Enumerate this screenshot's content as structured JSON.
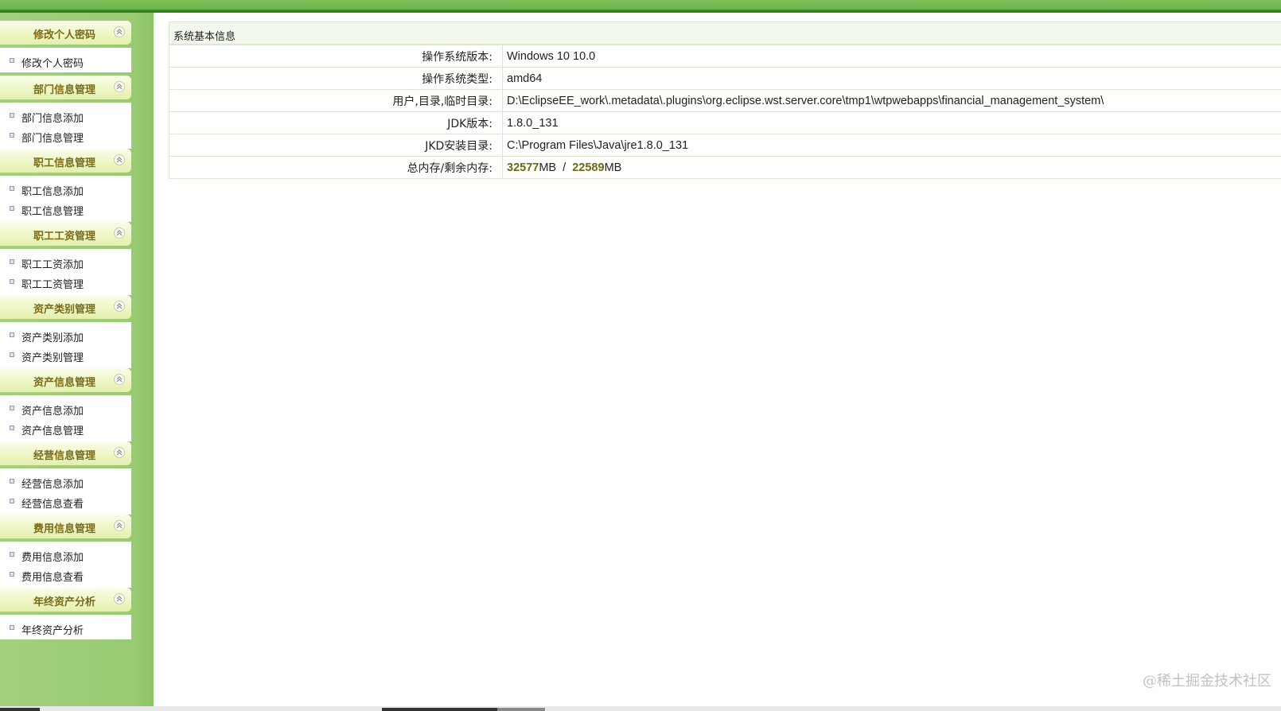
{
  "sidebar": {
    "groups": [
      {
        "title": "修改个人密码",
        "items": [
          "修改个人密码"
        ]
      },
      {
        "title": "部门信息管理",
        "items": [
          "部门信息添加",
          "部门信息管理"
        ]
      },
      {
        "title": "职工信息管理",
        "items": [
          "职工信息添加",
          "职工信息管理"
        ]
      },
      {
        "title": "职工工资管理",
        "items": [
          "职工工资添加",
          "职工工资管理"
        ]
      },
      {
        "title": "资产类别管理",
        "items": [
          "资产类别添加",
          "资产类别管理"
        ]
      },
      {
        "title": "资产信息管理",
        "items": [
          "资产信息添加",
          "资产信息管理"
        ]
      },
      {
        "title": "经营信息管理",
        "items": [
          "经营信息添加",
          "经营信息查看"
        ]
      },
      {
        "title": "费用信息管理",
        "items": [
          "费用信息添加",
          "费用信息查看"
        ]
      },
      {
        "title": "年终资产分析",
        "items": [
          "年终资产分析"
        ]
      }
    ],
    "toggle_icon": "collapse-up-icon"
  },
  "main": {
    "panel_title": "系统基本信息",
    "rows": [
      {
        "label": "操作系统版本:",
        "value": "Windows 10  10.0"
      },
      {
        "label": "操作系统类型:",
        "value": "amd64"
      },
      {
        "label": "用户,目录,临时目录:",
        "value": "D:\\EclipseEE_work\\.metadata\\.plugins\\org.eclipse.wst.server.core\\tmp1\\wtpwebapps\\financial_management_system\\"
      },
      {
        "label": "JDK版本:",
        "value": "1.8.0_131"
      },
      {
        "label": "JKD安装目录:",
        "value": "C:\\Program Files\\Java\\jre1.8.0_131"
      }
    ],
    "memory": {
      "label": "总内存/剩余内存:",
      "total": "32577",
      "total_unit": "MB",
      "separator": "/",
      "free": "22589",
      "free_unit": "MB"
    }
  },
  "watermark": "@稀土掘金技术社区",
  "colors": {
    "sidebar_bg": "#9acb74",
    "topbar": "#6fb64c",
    "group_title": "#7a6a1a",
    "memory_number": "#6b6a12"
  }
}
